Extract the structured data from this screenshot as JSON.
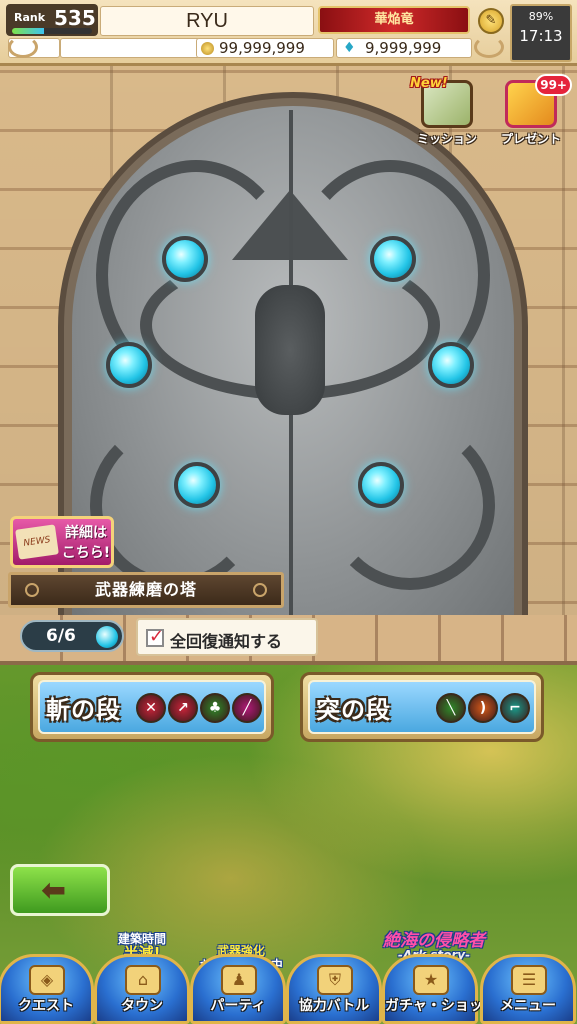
{
  "header": {
    "rank_label": "Rank",
    "rank_value": "535",
    "rank_progress": 0.4,
    "player_name": "RYU",
    "title_badge": "華焔竜",
    "gold": "99,999,999",
    "water": "9,999,999",
    "battery": "89%",
    "time": "17:13"
  },
  "corner": {
    "mission": {
      "label": "ミッション",
      "tag": "New!"
    },
    "present": {
      "label": "プレゼント",
      "badge": "99+"
    }
  },
  "tower": {
    "news_label": "NEWS",
    "detail_line1": "詳細は",
    "detail_line2": "こちら!",
    "name": "武器練磨の塔",
    "stamina": "6/6",
    "notify_label": "全回復通知する",
    "notify_checked": true
  },
  "stages": [
    {
      "title": "斬の段",
      "weapons": [
        "sword-icon",
        "dagger-icon",
        "claw-icon",
        "rod-icon"
      ],
      "colors": [
        "#c9243a",
        "#c9243a",
        "#2f8a2a",
        "#b01a78"
      ]
    },
    {
      "title": "突の段",
      "weapons": [
        "spear-icon",
        "bow-icon",
        "gun-icon"
      ],
      "colors": [
        "#2f8a2a",
        "#d45a1a",
        "#1a9a8a"
      ]
    }
  ],
  "promos": {
    "build_line1": "建築時間",
    "build_line2": "半減!",
    "weapon_line1": "武器強化",
    "weapon_line2": "キャンペーン中",
    "ark_line1": "絶海の侵略者",
    "ark_line2": "-Ark story-"
  },
  "nav": [
    {
      "label": "クエスト",
      "icon": "map-icon"
    },
    {
      "label": "タウン",
      "icon": "town-icon"
    },
    {
      "label": "パーティ",
      "icon": "party-icon"
    },
    {
      "label": "協力バトル",
      "icon": "shield-icon"
    },
    {
      "label": "ガチャ・ショップ",
      "icon": "gacha-icon"
    },
    {
      "label": "メニュー",
      "icon": "menu-icon"
    }
  ]
}
